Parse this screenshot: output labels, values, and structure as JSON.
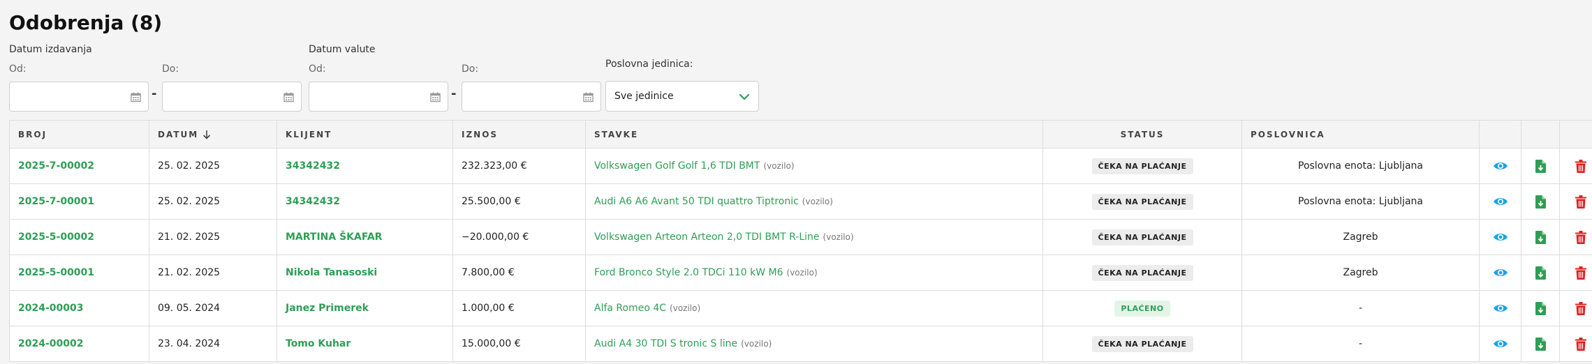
{
  "page": {
    "title": "Odobrenja (8)"
  },
  "filters": {
    "issue_date": {
      "label": "Datum izdavanja",
      "from_label": "Od:",
      "to_label": "Do:",
      "from_value": "",
      "to_value": ""
    },
    "value_date": {
      "label": "Datum valute",
      "from_label": "Od:",
      "to_label": "Do:",
      "from_value": "",
      "to_value": ""
    },
    "unit": {
      "label": "Poslovna jedinica:",
      "selected": "Sve jedinice"
    },
    "separator": "-"
  },
  "table": {
    "headers": {
      "broj": "BROJ",
      "datum": "DATUM",
      "klijent": "KLIJENT",
      "iznos": "IZNOS",
      "stavke": "STAVKE",
      "status": "STATUS",
      "poslovnica": "POSLOVNICA"
    },
    "rows": [
      {
        "broj": "2025-7-00002",
        "datum": "25. 02. 2025",
        "klijent": "34342432",
        "iznos": "232.323,00 €",
        "stavka": "Volkswagen Golf Golf 1,6 TDI BMT",
        "tip": "(vozilo)",
        "status": "ČEKA NA PLAĆANJE",
        "status_type": "wait",
        "poslovnica": "Poslovna enota: Ljubljana"
      },
      {
        "broj": "2025-7-00001",
        "datum": "25. 02. 2025",
        "klijent": "34342432",
        "iznos": "25.500,00 €",
        "stavka": "Audi A6 A6 Avant 50 TDI quattro Tiptronic",
        "tip": "(vozilo)",
        "status": "ČEKA NA PLAĆANJE",
        "status_type": "wait",
        "poslovnica": "Poslovna enota: Ljubljana"
      },
      {
        "broj": "2025-5-00002",
        "datum": "21. 02. 2025",
        "klijent": "MARTINA ŠKAFAR",
        "iznos": "−20.000,00 €",
        "stavka": "Volkswagen Arteon Arteon 2,0 TDI BMT R-Line",
        "tip": "(vozilo)",
        "status": "ČEKA NA PLAĆANJE",
        "status_type": "wait",
        "poslovnica": "Zagreb"
      },
      {
        "broj": "2025-5-00001",
        "datum": "21. 02. 2025",
        "klijent": "Nikola Tanasoski",
        "iznos": "7.800,00 €",
        "stavka": "Ford Bronco Style 2.0 TDCi 110 kW M6",
        "tip": "(vozilo)",
        "status": "ČEKA NA PLAĆANJE",
        "status_type": "wait",
        "poslovnica": "Zagreb"
      },
      {
        "broj": "2024-00003",
        "datum": "09. 05. 2024",
        "klijent": "Janez Primerek",
        "iznos": "1.000,00 €",
        "stavka": "Alfa Romeo 4C",
        "tip": "(vozilo)",
        "status": "PLAĆENO",
        "status_type": "paid",
        "poslovnica": "-"
      },
      {
        "broj": "2024-00002",
        "datum": "23. 04. 2024",
        "klijent": "Tomo Kuhar",
        "iznos": "15.000,00 €",
        "stavka": "Audi A4 30 TDI S tronic S line",
        "tip": "(vozilo)",
        "status": "ČEKA NA PLAĆANJE",
        "status_type": "wait",
        "poslovnica": "-"
      }
    ]
  },
  "icons": {
    "view": "eye-icon",
    "download": "file-download-icon",
    "delete": "trash-icon",
    "calendar": "calendar-icon",
    "sort": "arrow-down-icon",
    "chevron": "chevron-down-icon"
  },
  "colors": {
    "accent": "#2e9e55",
    "view": "#1aa3e8",
    "delete": "#e02020",
    "paid_bg": "#e3f5e7",
    "wait_bg": "#ececec"
  }
}
